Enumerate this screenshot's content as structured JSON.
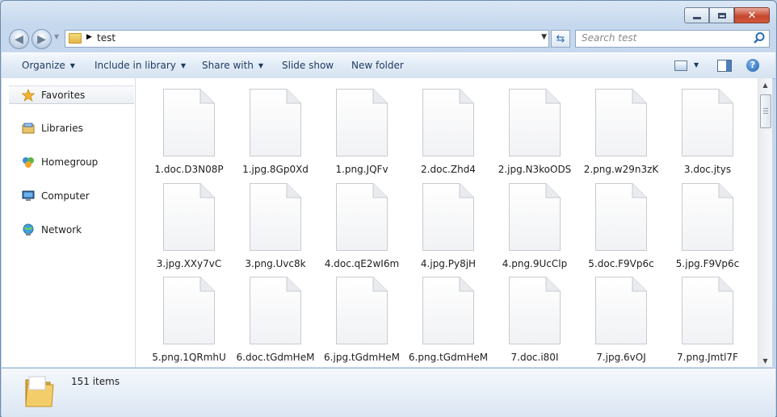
{
  "window": {
    "close_glyph": "✕"
  },
  "address": {
    "path": "test"
  },
  "search": {
    "placeholder": "Search test"
  },
  "toolbar": {
    "organize": "Organize",
    "include_in_library": "Include in library",
    "share_with": "Share with",
    "slide_show": "Slide show",
    "new_folder": "New folder",
    "help": "?"
  },
  "sidebar": {
    "items": [
      {
        "label": "Favorites",
        "icon": "star-icon"
      },
      {
        "label": "Libraries",
        "icon": "library-icon"
      },
      {
        "label": "Homegroup",
        "icon": "homegroup-icon"
      },
      {
        "label": "Computer",
        "icon": "computer-icon"
      },
      {
        "label": "Network",
        "icon": "network-icon"
      }
    ]
  },
  "files": [
    "1.doc.D3N08P",
    "1.jpg.8Gp0Xd",
    "1.png.JQFv",
    "2.doc.Zhd4",
    "2.jpg.N3koODS",
    "2.png.w29n3zK",
    "3.doc.jtys",
    "3.jpg.XXy7vC",
    "3.png.Uvc8k",
    "4.doc.qE2wI6m",
    "4.jpg.Py8jH",
    "4.png.9UcClp",
    "5.doc.F9Vp6c",
    "5.jpg.F9Vp6c",
    "5.png.1QRmhU",
    "6.doc.tGdmHeM",
    "6.jpg.tGdmHeM",
    "6.png.tGdmHeM",
    "7.doc.i80I",
    "7.jpg.6vOJ",
    "7.png.Jmtl7F"
  ],
  "details": {
    "count": "151 items"
  },
  "colors": {
    "folder": "#e8b84a",
    "accent": "#2d6bb5",
    "close": "#c7472f"
  }
}
